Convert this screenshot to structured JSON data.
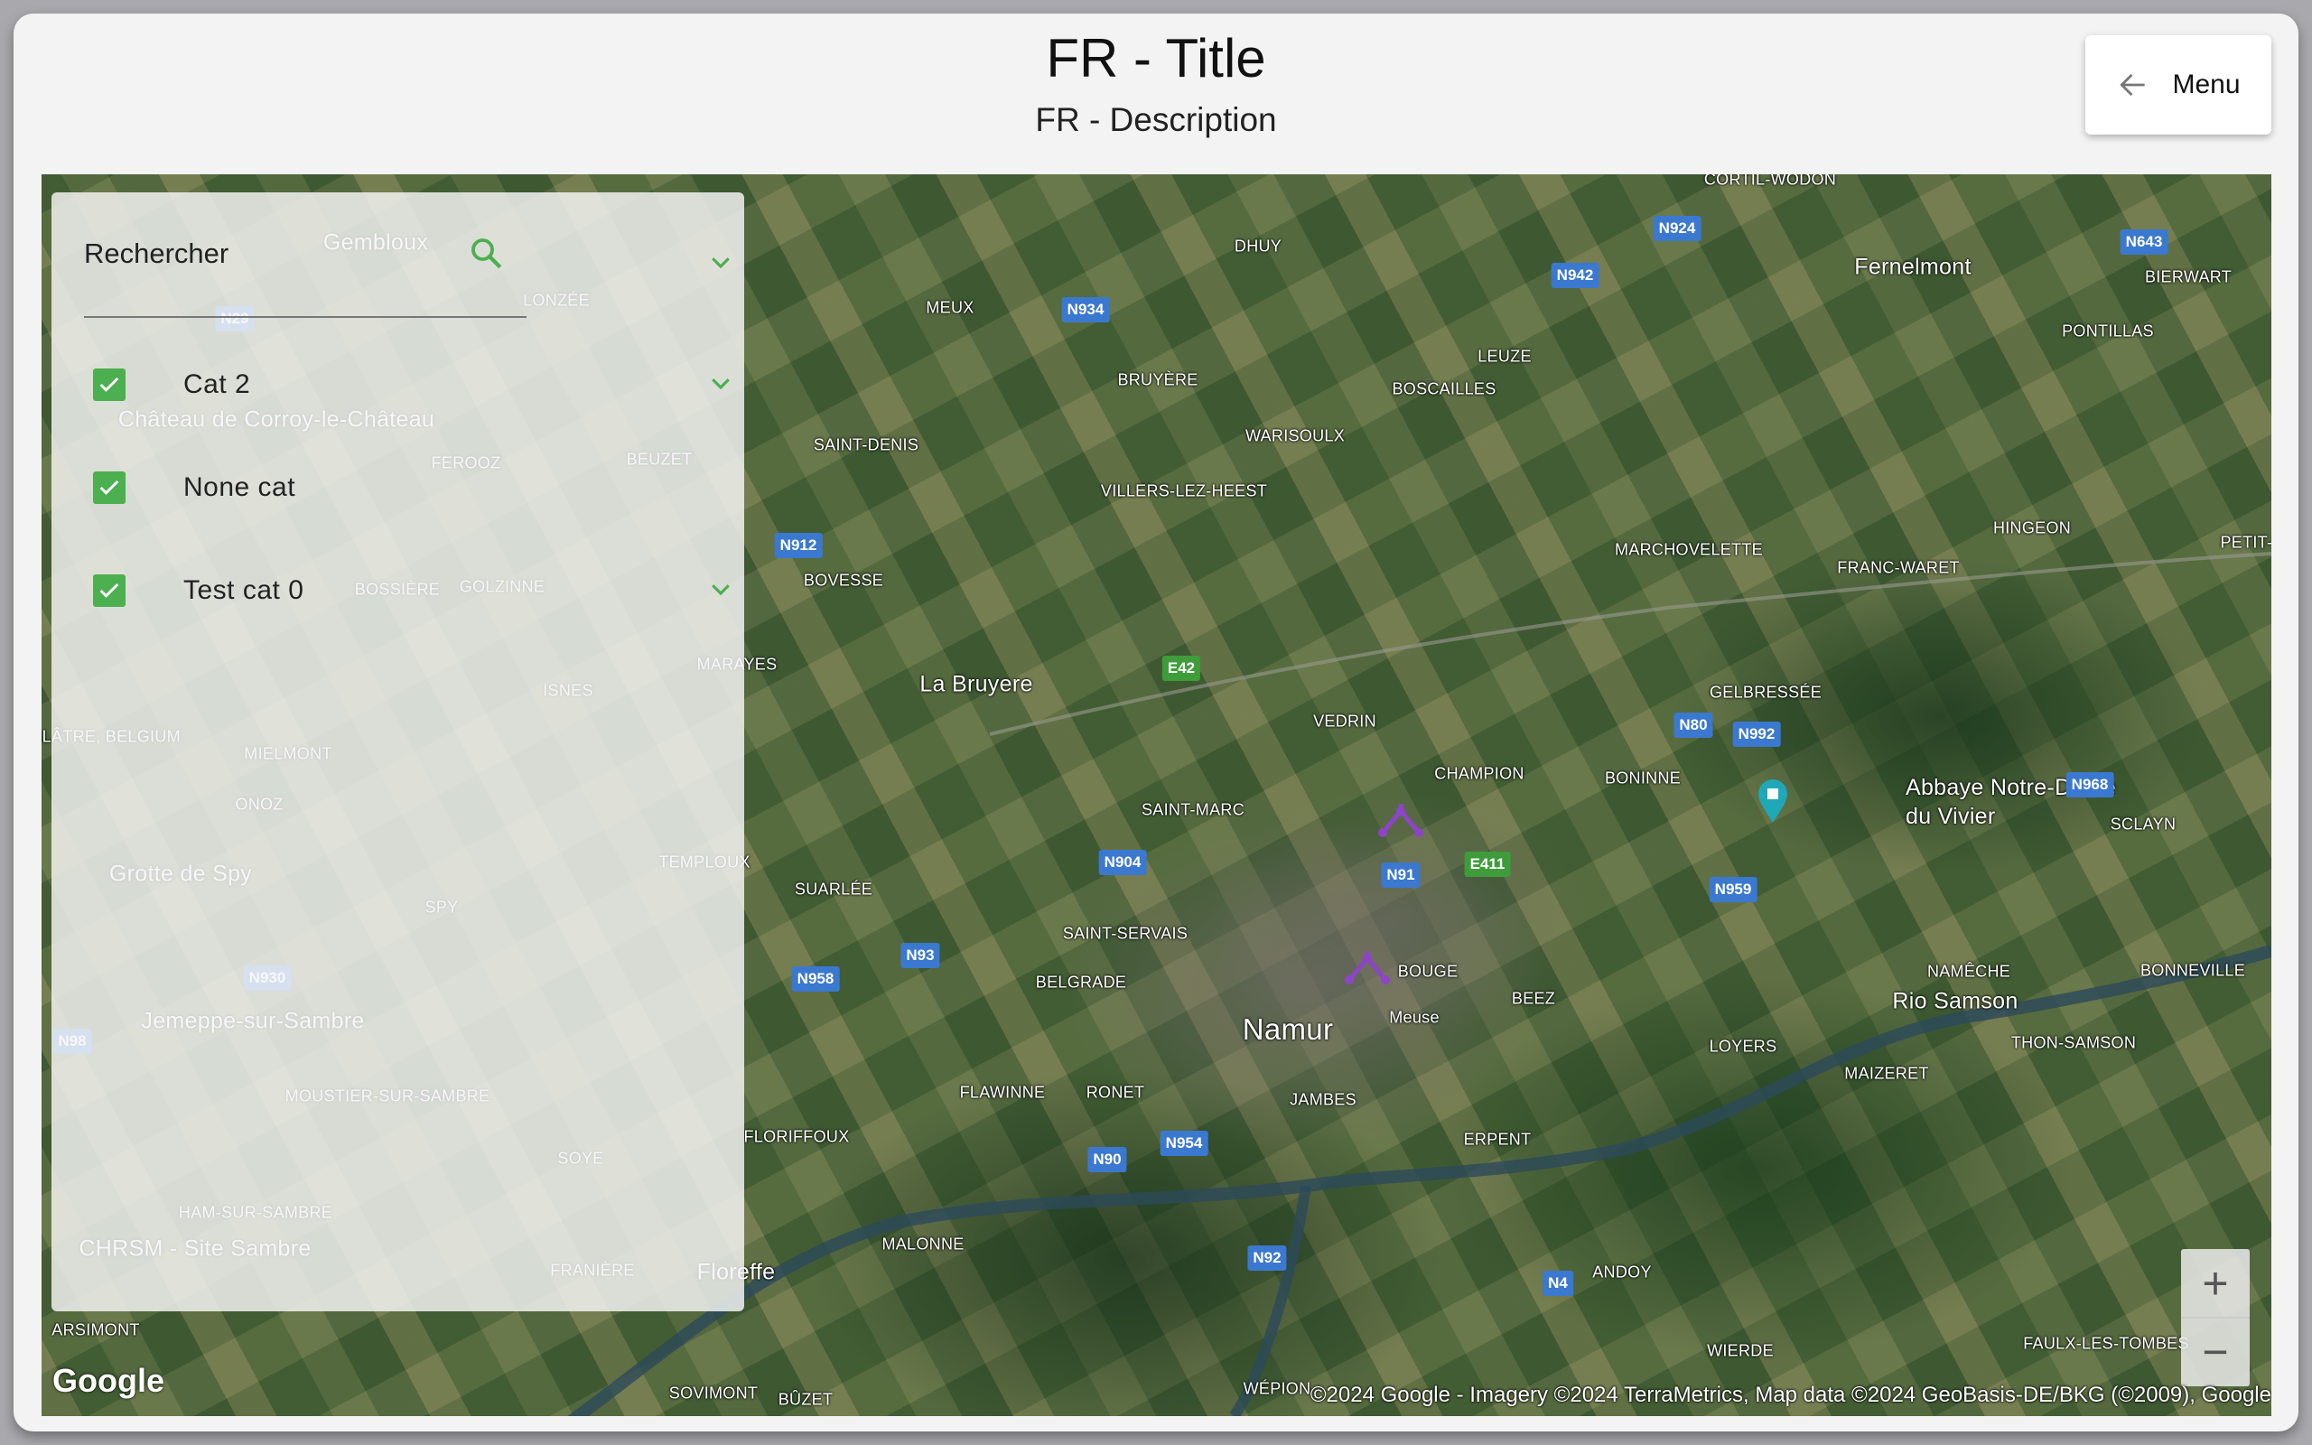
{
  "header": {
    "title": "FR - Title",
    "description": "FR - Description",
    "menu_label": "Menu",
    "menu_icon": "arrow-left-icon"
  },
  "sidebar": {
    "search_label": "Rechercher",
    "search_icon": "search-icon",
    "categories": [
      {
        "label": "Cat 2",
        "checked": true
      },
      {
        "label": "None cat",
        "checked": true
      },
      {
        "label": "Test cat 0",
        "checked": true
      }
    ]
  },
  "map": {
    "places": [
      "Namur",
      "La Bruyere",
      "Fernelmont",
      "Abbaye Notre-Dame du Vivier",
      "Rio Samson",
      "CORTIL-WODON",
      "DHUY",
      "MEUX",
      "BRUYÈRE",
      "LEUZE",
      "BOSCAILLES",
      "WARISOULX",
      "SAINT-DENIS",
      "VILLERS-LEZ-HEEST",
      "BOVESSE",
      "MARCHOVELETTE",
      "FRANC-WARET",
      "HINGEON",
      "PONTILLAS",
      "BIERWART",
      "GELBRESSÉE",
      "VEDRIN",
      "CHAMPION",
      "BONINNE",
      "SAINT-MARC",
      "SUARLÉE",
      "SAINT-SERVAIS",
      "BELGRADE",
      "BOUGE",
      "BEEZ",
      "SCLAYN",
      "NAMÊCHE",
      "BONNEVILLE",
      "THON-SAMSON",
      "LOYERS",
      "MAIZERET",
      "FLAWINNE",
      "RONET",
      "JAMBES",
      "ERPENT",
      "FLORIFFOUX",
      "MALONNE",
      "ANDOY",
      "WIERDE",
      "FAULX-LES-TOMBES",
      "ARSIMONT",
      "SOVIMONT",
      "BÛZET",
      "WÉPION",
      "Floreffe",
      "Gembloux",
      "LONZÉE",
      "Château de Corroy-le-Château",
      "FEROOZ",
      "BEUZET",
      "BOSSIÈRE",
      "GOLZINNE",
      "MARAYES",
      "ISNES",
      "MIELMONT",
      "ONOZ",
      "Grotte de Spy",
      "SPY",
      "TEMPLOUX",
      "Jemeppe-sur-Sambre",
      "MOUSTIER-SUR-SAMBRE",
      "SOYE",
      "HAM-SUR-SAMBRE",
      "CHRSM - Site Sambre",
      "FRANIÈRE",
      "BALÂTRE, BELGIUM",
      "Meuse",
      "PETIT-W"
    ],
    "roads": [
      "N924",
      "N643",
      "N942",
      "N934",
      "N912",
      "E42",
      "N80",
      "N992",
      "N968",
      "N904",
      "N91",
      "E411",
      "N959",
      "N93",
      "N958",
      "N90",
      "N954",
      "N92",
      "N4",
      "N29",
      "N930",
      "N98"
    ],
    "zoom_in": "+",
    "zoom_out": "−",
    "logo": "Google",
    "attribution": "©2024 Google - Imagery ©2024 TerraMetrics, Map data ©2024 GeoBasis-DE/BKG (©2009), Google",
    "marker_color": "#8e44c8",
    "accent": "#4caf50"
  }
}
